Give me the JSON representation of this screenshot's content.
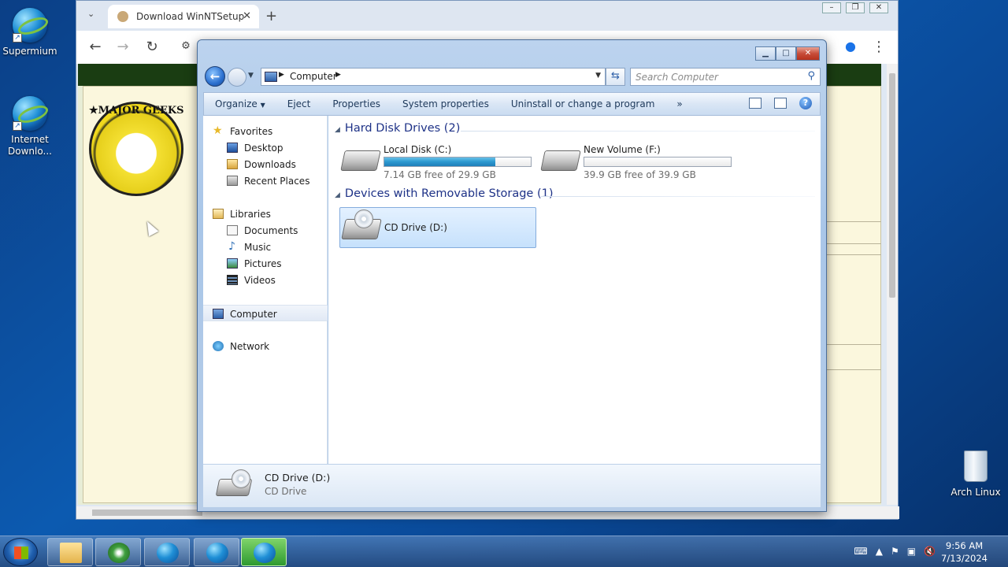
{
  "desktop": {
    "icons": [
      {
        "label": "Supermium"
      },
      {
        "label": "Internet Downlo..."
      }
    ],
    "recycle_label": "Arch Linux"
  },
  "browser": {
    "tab_title": "Download WinNTSetup",
    "close_tab_glyph": "✕",
    "new_tab_glyph": "+",
    "back_glyph": "←",
    "forward_glyph": "→",
    "reload_glyph": "↻",
    "menu_glyph": "⋮",
    "site_logo_text": "★MAJOR GEEKS"
  },
  "explorer": {
    "address": {
      "location": "Computer"
    },
    "search_placeholder": "Search Computer",
    "toolbar": {
      "organize": "Organize",
      "eject": "Eject",
      "properties": "Properties",
      "system_properties": "System properties",
      "uninstall": "Uninstall or change a program",
      "more": "»"
    },
    "nav": {
      "favorites": "Favorites",
      "desktop": "Desktop",
      "downloads": "Downloads",
      "recent_places": "Recent Places",
      "libraries": "Libraries",
      "documents": "Documents",
      "music": "Music",
      "pictures": "Pictures",
      "videos": "Videos",
      "computer": "Computer",
      "network": "Network"
    },
    "groups": {
      "hard_disk": "Hard Disk Drives (2)",
      "removable": "Devices with Removable Storage (1)"
    },
    "drives": [
      {
        "name": "Local Disk (C:)",
        "free_text": "7.14 GB free of 29.9 GB",
        "used_fraction": 0.76
      },
      {
        "name": "New Volume (F:)",
        "free_text": "39.9 GB free of 39.9 GB",
        "used_fraction": 0.0
      }
    ],
    "cd": {
      "name": "CD Drive (D:)"
    },
    "details": {
      "name": "CD Drive (D:)",
      "type": "CD Drive"
    }
  },
  "taskbar": {
    "time": "9:56 AM",
    "date": "7/13/2024"
  },
  "colors": {
    "accent": "#2c98cf",
    "group_heading": "#1e3287"
  }
}
